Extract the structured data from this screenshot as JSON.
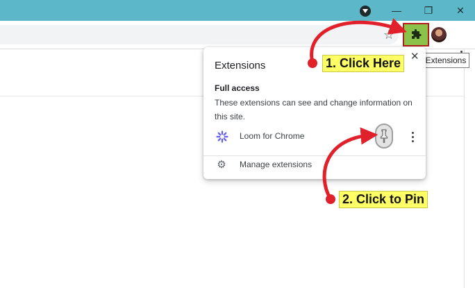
{
  "window": {
    "controls": {
      "minimize_symbol": "—",
      "restore_symbol": "❐",
      "close_symbol": "✕"
    }
  },
  "toolbar": {
    "bookmark_icon": "star-icon",
    "extensions_icon": "puzzle-piece-icon",
    "menu_icon": "kebab-icon"
  },
  "tooltip": {
    "text": "Extensions"
  },
  "extensions_popup": {
    "title": "Extensions",
    "close_symbol": "✕",
    "section_heading": "Full access",
    "section_description": "These extensions can see and change information on this site.",
    "extensions": [
      {
        "name": "Loom for Chrome",
        "icon": "loom-icon",
        "pin_icon": "pin-icon"
      }
    ],
    "manage_label": "Manage extensions",
    "manage_icon": "gear-icon"
  },
  "annotations": {
    "step1": "1. Click Here",
    "step2": "2. Click to Pin",
    "highlight_color": "#ffff66",
    "arrow_color": "#e0202a",
    "box_color": "#b71c1c"
  },
  "colors": {
    "titlebar": "#5cb8c8",
    "extension_button_bg": "#8bc34a",
    "loom_purple": "#625df5"
  }
}
